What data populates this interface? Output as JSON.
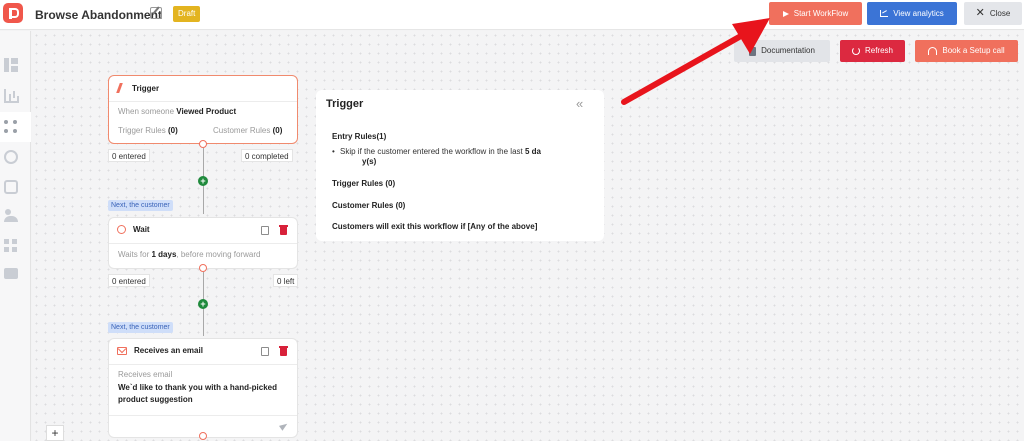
{
  "header": {
    "title": "Browse Abandonment",
    "status_badge": "Draft",
    "start_button": "Start WorkFlow",
    "analytics_button": "View analytics",
    "close_button": "Close"
  },
  "toolbar": {
    "documentation_button": "Documentation",
    "refresh_button": "Refresh",
    "setup_button": "Book a Setup call"
  },
  "nodes": {
    "trigger": {
      "title": "Trigger",
      "desc_prefix": "When someone ",
      "desc_bold": "Viewed Product",
      "trigger_rules_label": "Trigger Rules ",
      "trigger_rules_count": "(0)",
      "customer_rules_label": "Customer Rules ",
      "customer_rules_count": "(0)",
      "entered": "0 entered",
      "completed": "0 completed"
    },
    "tag1": "Next, the customer",
    "wait": {
      "title": "Wait",
      "desc_prefix": "Waits for ",
      "desc_bold": "1 days",
      "desc_suffix": ", before moving forward",
      "entered": "0 entered",
      "left": "0 left"
    },
    "tag2": "Next, the customer",
    "email": {
      "title": "Receives an email",
      "subtitle": "Receives email",
      "body_line1": "We`d like to thank you with a hand-picked",
      "body_line2": "product suggestion"
    }
  },
  "panel": {
    "title": "Trigger",
    "entry_rules": "Entry Rules(1)",
    "entry_rule_text": "Skip if the customer entered the workflow in the last ",
    "entry_rule_bold": "5 da",
    "entry_rule_wrap": "y(s)",
    "trigger_rules": "Trigger Rules  (0)",
    "customer_rules": "Customer Rules  (0)",
    "exit_rule": "Customers will exit this workflow if [Any of the above]"
  },
  "canvas": {
    "zoom_in": "+"
  },
  "colors": {
    "accent": "#f0705d",
    "primary_blue": "#3b74d6",
    "danger": "#dc2940",
    "draft": "#e3b420",
    "arrow": "#e8141c"
  }
}
